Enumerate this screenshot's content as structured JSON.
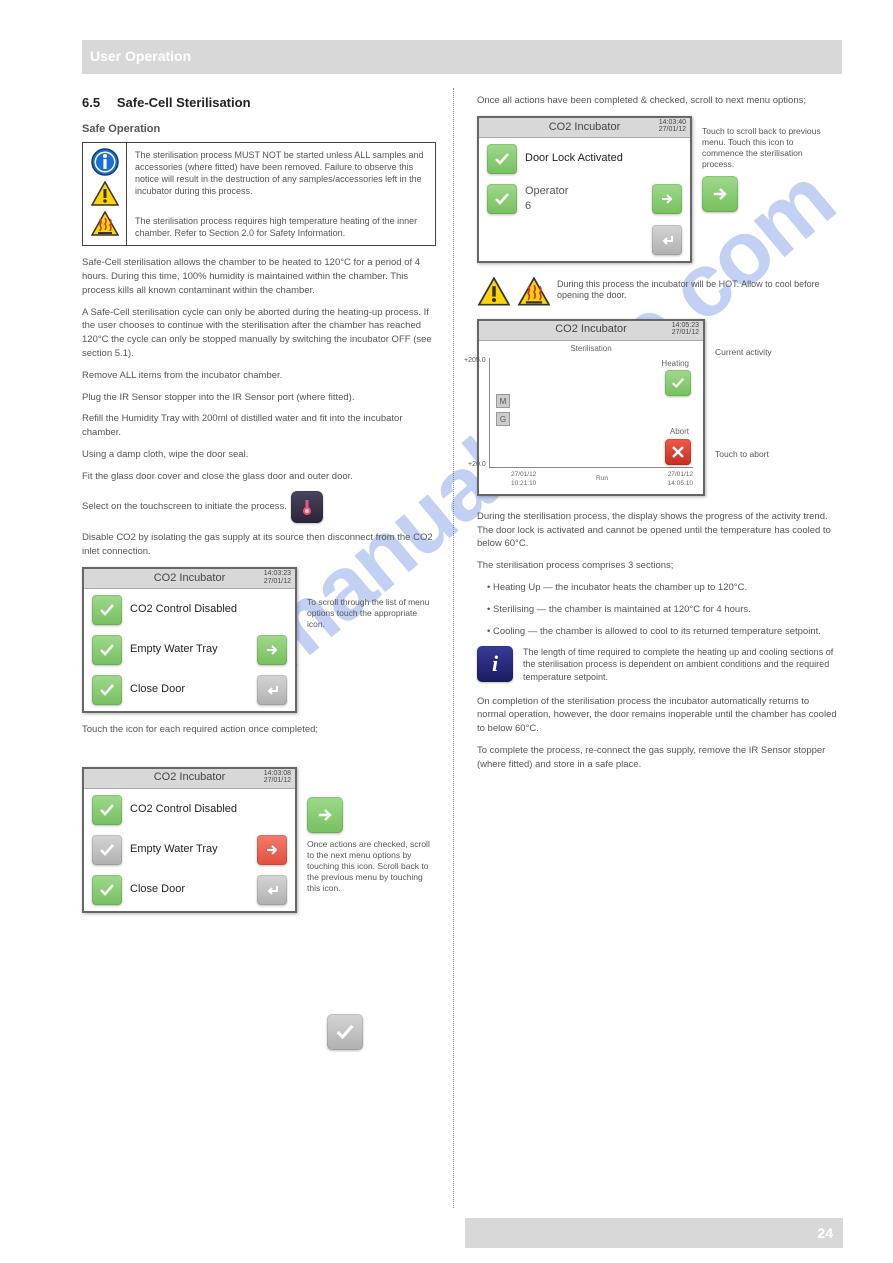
{
  "header": {
    "title": "User Operation"
  },
  "left": {
    "section_num": "6.5",
    "section_title": "Safe-Cell Sterilisation",
    "safe_heading": "Safe Operation",
    "note_items": [
      "The sterilisation process MUST NOT be started unless ALL samples and accessories (where fitted) have been removed. Failure to observe this notice will result in the destruction of any samples/accessories left in the incubator during this process.",
      "The sterilisation process requires high temperature heating of the inner chamber. Refer to Section 2.0 for Safety Information."
    ],
    "body": [
      "Safe-Cell sterilisation allows the chamber to be heated to 120°C for a period of 4 hours. During this time, 100% humidity is maintained within the chamber. This process kills all known contaminant within the chamber.",
      "A Safe-Cell sterilisation cycle can only be aborted during the heating-up process. If the user chooses to continue with the sterilisation after the chamber has reached 120°C the cycle can only be stopped manually by switching the incubator OFF (see section 5.1).",
      "Remove ALL items from the incubator chamber.",
      "Plug the IR Sensor stopper into the IR Sensor port (where fitted).",
      "Refill the Humidity Tray with 200ml of distilled water and fit into the incubator chamber.",
      "Using a damp cloth, wipe the door seal.",
      "Fit the glass door cover and close the glass door and outer door.",
      "Select        on the touchscreen to initiate the process.",
      "Disable CO2 by isolating the gas supply at its source then disconnect from the CO2 inlet connection."
    ],
    "screen1": {
      "title": "CO2 Incubator",
      "time": "14:03:23",
      "date": "27/01/12",
      "items": [
        {
          "label": "CO2 Control Disabled"
        },
        {
          "label": "Empty Water Tray"
        },
        {
          "label": "Close Door"
        }
      ],
      "callout": "To scroll through the list of menu options touch the appropriate icon."
    },
    "mid_para": "Touch the          icon for each required action once completed;",
    "screen2": {
      "title": "CO2 Incubator",
      "time": "14:03:08",
      "date": "27/01/12",
      "items": [
        {
          "label": "CO2 Control Disabled"
        },
        {
          "label": "Empty Water Tray"
        },
        {
          "label": "Close Door"
        }
      ],
      "side": "Once actions are checked, scroll to the next menu options by touching this icon. Scroll back to the previous menu by touching this icon."
    }
  },
  "right": {
    "intro": "Once all actions have been completed & checked, scroll to next menu options;",
    "screen3": {
      "title": "CO2 Incubator",
      "time": "14:03:40",
      "date": "27/01/12",
      "items": [
        {
          "label": "Door Lock Activated"
        },
        {
          "label": "Operator",
          "sub": "6"
        }
      ],
      "side": "Touch to scroll back to previous menu. Touch this icon to commence the sterilisation process."
    },
    "warn_text": "During this process the incubator will be HOT. Allow to cool before opening the door.",
    "screen4": {
      "title": "CO2 Incubator",
      "time": "14:05:23",
      "date": "27/01/12",
      "sterilisation": "Sterilisation",
      "heating": "Heating",
      "abort": "Abort",
      "run": "Run",
      "ymax": "+205.0",
      "ymin": "+20.0",
      "t1": "27/01/12",
      "t1b": "10:21:10",
      "t2": "27/01/12",
      "t2b": "14:05:10",
      "m": "M",
      "g": "G",
      "callout1": "Current activity",
      "callout2": "Touch to abort"
    },
    "after_paras": [
      "During the sterilisation process, the display shows the progress of the activity trend. The door lock is activated and cannot be opened until the temperature has cooled to below 60°C.",
      "The sterilisation process comprises 3 sections;",
      "• Heating Up — the incubator heats the chamber up to 120°C.",
      "• Sterilising — the chamber is maintained at 120°C for 4 hours.",
      "• Cooling — the chamber is allowed to cool to its returned temperature setpoint."
    ],
    "info_text": "The length of time required to complete the heating up and cooling sections of the sterilisation process is dependent on ambient conditions and the required temperature setpoint.",
    "final_paras": [
      "On completion of the sterilisation process the incubator automatically returns to normal operation, however, the door remains inoperable until the chamber has cooled to below 60°C.",
      "To complete the process, re-connect the gas supply, remove the IR Sensor stopper (where fitted) and store in a safe place."
    ]
  },
  "footer": {
    "page": "24"
  },
  "watermark": "manualshive.com"
}
